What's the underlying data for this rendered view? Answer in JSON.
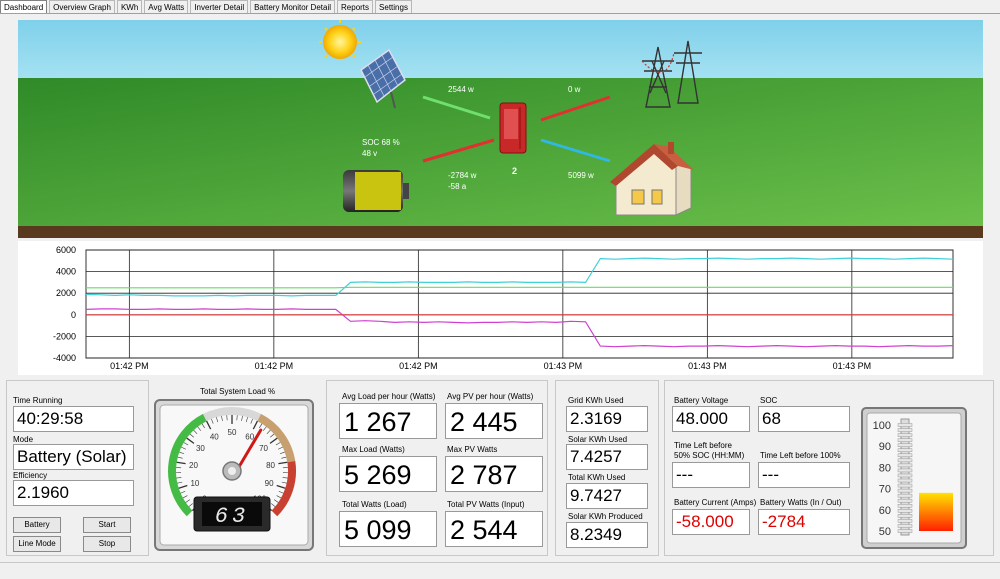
{
  "tabs": [
    "Dashboard",
    "Overview Graph",
    "KWh",
    "Avg Watts",
    "Inverter Detail",
    "Battery Monitor Detail",
    "Reports",
    "Settings"
  ],
  "scene": {
    "pv_flow": "2544 w",
    "grid_flow": "0 w",
    "soc_line1": "SOC 68 %",
    "soc_line2": "48 v",
    "battery_flow_w": "-2784 w",
    "battery_flow_a": "-58 a",
    "inverter_number": "2",
    "load_flow": "5099 w",
    "battery_fill_color": "#c9c40f",
    "sky_color": "#8fd6ec",
    "grass_color": "#3f9b2c"
  },
  "chart_data": {
    "type": "line",
    "ylim": [
      -4000,
      6000
    ],
    "yticks": [
      "6000",
      "4000",
      "2000",
      "0",
      "-2000",
      "-4000"
    ],
    "xticks": [
      "01:42 PM",
      "01:42 PM",
      "01:42 PM",
      "01:43 PM",
      "01:43 PM",
      "01:43 PM"
    ],
    "grid": true,
    "n_points": 60,
    "series": [
      {
        "color": "#40d0d8",
        "values": [
          1900,
          1850,
          1800,
          1850,
          1800,
          1800,
          1750,
          1750,
          1750,
          1800,
          1750,
          1800,
          1800,
          1800,
          1750,
          1800,
          1800,
          1800,
          3000,
          3050,
          3000,
          3000,
          3050,
          3000,
          3000,
          3000,
          3050,
          3000,
          3000,
          3050,
          3000,
          3000,
          3000,
          3050,
          3000,
          5200,
          5150,
          5200,
          5250,
          5200,
          5150,
          5200,
          5200,
          5250,
          5200,
          5150,
          5200,
          5200,
          5250,
          5200,
          5150,
          5200,
          5250,
          5200,
          5200,
          5150,
          5200,
          5250,
          5200,
          5150
        ]
      },
      {
        "color": "#60e060",
        "values": [
          2500,
          2500,
          2500,
          2500,
          2500,
          2500,
          2500,
          2500,
          2500,
          2500,
          2500,
          2500,
          2500,
          2500,
          2500,
          2500,
          2500,
          2500,
          2550,
          2550,
          2550,
          2550,
          2550,
          2550,
          2550,
          2550,
          2550,
          2550,
          2550,
          2550,
          2550,
          2550,
          2550,
          2550,
          2550,
          2550,
          2550,
          2550,
          2550,
          2550,
          2550,
          2550,
          2550,
          2550,
          2550,
          2550,
          2550,
          2550,
          2550,
          2550,
          2550,
          2550,
          2550,
          2550,
          2550,
          2550,
          2550,
          2550,
          2550,
          2550
        ]
      },
      {
        "color": "#d040d0",
        "values": [
          500,
          550,
          550,
          500,
          500,
          550,
          500,
          500,
          550,
          500,
          500,
          550,
          500,
          500,
          550,
          500,
          500,
          500,
          -600,
          -550,
          -600,
          -700,
          -650,
          -700,
          -650,
          -700,
          -750,
          -700,
          -700,
          -650,
          -700,
          -650,
          -700,
          -600,
          -650,
          -2900,
          -2950,
          -2900,
          -2850,
          -2900,
          -2950,
          -2900,
          -2900,
          -2850,
          -2900,
          -2950,
          -2900,
          -2850,
          -2900,
          -2950,
          -2900,
          -2850,
          -2900,
          -2900,
          -2950,
          -2900,
          -2850,
          -2900,
          -2900,
          -2850
        ]
      },
      {
        "color": "#e04040",
        "values": [
          0,
          0,
          0,
          0,
          0,
          0,
          0,
          0,
          0,
          0,
          0,
          0,
          0,
          0,
          0,
          0,
          0,
          0,
          0,
          0,
          0,
          0,
          0,
          0,
          0,
          0,
          0,
          0,
          0,
          0,
          0,
          0,
          0,
          0,
          0,
          0,
          0,
          0,
          0,
          0,
          0,
          0,
          0,
          0,
          0,
          0,
          0,
          0,
          0,
          0,
          0,
          0,
          0,
          0,
          0,
          0,
          0,
          0,
          0,
          0
        ]
      }
    ]
  },
  "status_panel": {
    "time_running_label": "Time Running",
    "time_running_value": "40:29:58",
    "mode_label": "Mode",
    "mode_value": "Battery (Solar)",
    "efficiency_label": "Efficiency",
    "efficiency_value": "2.1960",
    "battery_btn": "Battery",
    "start_btn": "Start",
    "line_mode_btn": "Line Mode",
    "stop_btn": "Stop"
  },
  "gauge": {
    "title": "Total System Load %",
    "value": 63,
    "display": "63",
    "ticks": [
      "0",
      "10",
      "20",
      "30",
      "40",
      "50",
      "60",
      "70",
      "80",
      "90",
      "100"
    ]
  },
  "load_panel": {
    "avg_load_label": "Avg Load per hour (Watts)",
    "avg_load_value": "1 267",
    "avg_pv_label": "Avg PV per hour (Watts)",
    "avg_pv_value": "2 445",
    "max_load_label": "Max Load (Watts)",
    "max_load_value": "5 269",
    "max_pv_label": "Max PV Watts",
    "max_pv_value": "2 787",
    "total_watts_label": "Total Watts (Load)",
    "total_watts_value": "5 099",
    "total_pv_label": "Total PV Watts (Input)",
    "total_pv_value": "2 544"
  },
  "kwh_panel": {
    "grid_label": "Grid KWh Used",
    "grid_value": "2.3169",
    "solar_label": "Solar KWh Used",
    "solar_value": "7.4257",
    "total_label": "Total KWh Used",
    "total_value": "9.7427",
    "produced_label": "Solar KWh Produced",
    "produced_value": "8.2349"
  },
  "battery_panel": {
    "voltage_label": "Battery Voltage",
    "voltage_value": "48.000",
    "soc_label": "SOC",
    "soc_value": "68",
    "time50_label1": "Time Left before",
    "time50_label2": "50% SOC (HH:MM)",
    "time50_value": "---",
    "time100_label": "Time Left before 100%",
    "time100_value": "---",
    "current_label": "Battery Current (Amps)",
    "current_value": "-58.000",
    "watts_label": "Battery Watts (In / Out)",
    "watts_value": "-2784"
  },
  "soc_meter": {
    "ticks": [
      "100",
      "90",
      "80",
      "70",
      "60",
      "50"
    ],
    "level": 68
  }
}
